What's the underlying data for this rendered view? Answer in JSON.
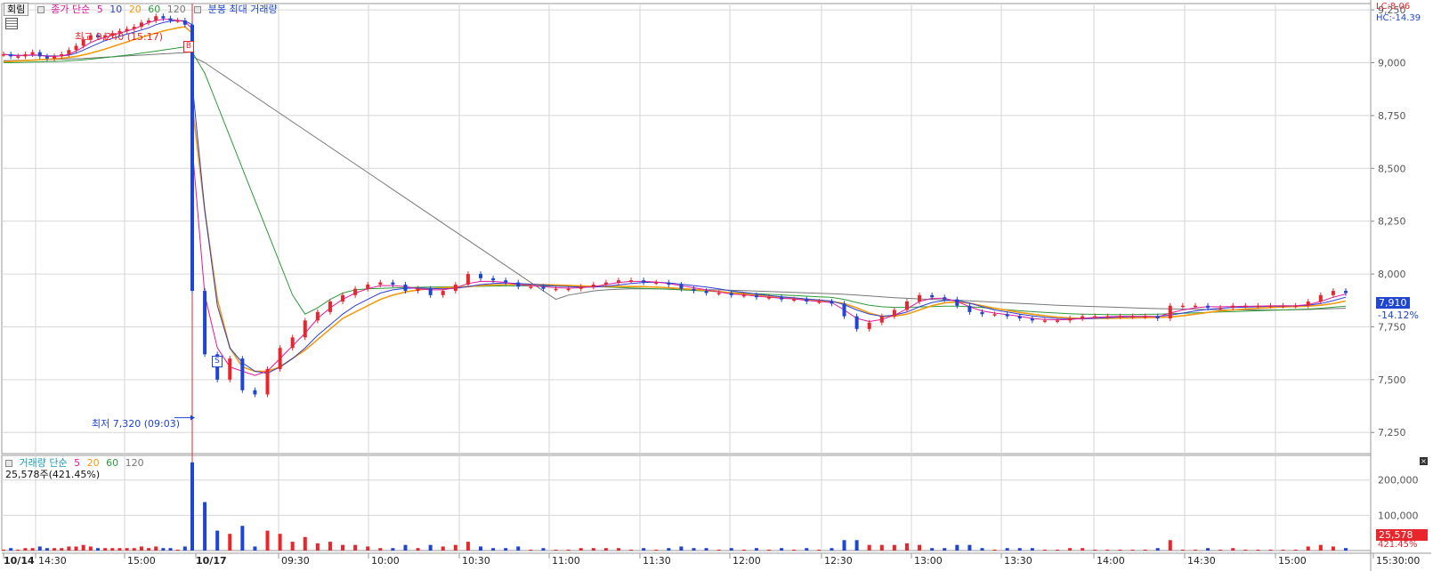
{
  "toolbar": {
    "mode_button": "회림",
    "price_legend": {
      "prefix": "종가 단순",
      "ma": [
        "5",
        "10",
        "20",
        "60",
        "120"
      ],
      "extra": "분봉 최대 거래량"
    },
    "volume_legend": {
      "prefix": "거래량 단순",
      "ma": [
        "5",
        "20",
        "60",
        "120"
      ],
      "current": "25,578주(421.45%)"
    }
  },
  "indicators": {
    "lc": "LC:8.06",
    "hc": "HC:-14.39"
  },
  "current_price": {
    "value": "7,910",
    "change": "-14.12%"
  },
  "current_volume": {
    "value": "25,578",
    "pct": "421.45%"
  },
  "annotations": {
    "high": "최고 9,240 (15:17)",
    "low": "최저 7,320 (09:03)",
    "buy_marker": "B",
    "sell_marker": "S"
  },
  "colors": {
    "up": "#e8262c",
    "down": "#1f45d1",
    "ma5": "#e0189c",
    "ma10": "#2e3fd7",
    "ma20": "#f29b0c",
    "ma60": "#2d9a3a",
    "ma120": "#777777",
    "grid": "#d6d6d6"
  },
  "chart_data": {
    "type": "line",
    "price_axis": {
      "ticks": [
        "9,250",
        "9,000",
        "8,750",
        "8,500",
        "8,250",
        "8,000",
        "7,750",
        "7,500",
        "7,250"
      ],
      "ylim": [
        7150,
        9280
      ]
    },
    "volume_axis": {
      "ticks": [
        "200,000",
        "100,000"
      ],
      "ylim": [
        0,
        270000
      ]
    },
    "x_ticks": [
      "10/14",
      "14:30",
      "15:00",
      "10/17",
      "09:30",
      "10:00",
      "10:30",
      "11:00",
      "11:30",
      "12:00",
      "12:30",
      "13:00",
      "13:30",
      "14:00",
      "14:30",
      "15:00",
      "15:30:00"
    ],
    "series": [
      {
        "name": "종가",
        "values": [
          9040,
          9030,
          9030,
          9040,
          9050,
          9030,
          9020,
          9030,
          9040,
          9060,
          9080,
          9110,
          9130,
          9120,
          9130,
          9140,
          9150,
          9160,
          9170,
          9190,
          9200,
          9220,
          9210,
          9200,
          9200,
          9180,
          9100,
          7920,
          7620,
          7500,
          7600,
          7450,
          7430,
          7550,
          7650,
          7700,
          7780,
          7820,
          7870,
          7900,
          7930,
          7950,
          7960,
          7950,
          7920,
          7930,
          7900,
          7920,
          7950,
          8000,
          7980,
          7970,
          7960,
          7940,
          7940,
          7930,
          7930,
          7930,
          7940,
          7950,
          7960,
          7970,
          7970,
          7960,
          7960,
          7950,
          7930,
          7920,
          7910,
          7910,
          7900,
          7900,
          7890,
          7890,
          7880,
          7880,
          7870,
          7870,
          7860,
          7800,
          7740,
          7770,
          7800,
          7830,
          7870,
          7900,
          7890,
          7880,
          7850,
          7820,
          7810,
          7810,
          7800,
          7790,
          7780,
          7780,
          7780,
          7790,
          7800,
          7800,
          7800,
          7800,
          7800,
          7800,
          7790,
          7850,
          7850,
          7850,
          7840,
          7840,
          7850,
          7850,
          7850,
          7850,
          7850,
          7850,
          7870,
          7900,
          7920,
          7910
        ]
      },
      {
        "name": "5",
        "values": [
          9040,
          9035,
          9033,
          9035,
          9038,
          9035,
          9030,
          9030,
          9032,
          9040,
          9055,
          9075,
          9095,
          9110,
          9120,
          9130,
          9140,
          9150,
          9160,
          9175,
          9190,
          9200,
          9205,
          9205,
          9200,
          9195,
          9160,
          8600,
          7900,
          7650,
          7560,
          7540,
          7520,
          7540,
          7600,
          7660,
          7720,
          7790,
          7840,
          7880,
          7910,
          7930,
          7945,
          7945,
          7940,
          7930,
          7925,
          7925,
          7935,
          7955,
          7965,
          7965,
          7960,
          7950,
          7945,
          7940,
          7935,
          7933,
          7935,
          7940,
          7950,
          7960,
          7965,
          7965,
          7962,
          7955,
          7945,
          7935,
          7925,
          7915,
          7905,
          7902,
          7895,
          7890,
          7885,
          7882,
          7875,
          7870,
          7865,
          7830,
          7790,
          7775,
          7785,
          7805,
          7835,
          7870,
          7885,
          7885,
          7870,
          7845,
          7825,
          7815,
          7808,
          7800,
          7790,
          7785,
          7783,
          7785,
          7790,
          7795,
          7798,
          7800,
          7800,
          7800,
          7797,
          7815,
          7830,
          7840,
          7845,
          7845,
          7846,
          7847,
          7848,
          7849,
          7850,
          7850,
          7855,
          7870,
          7890,
          7905
        ]
      },
      {
        "name": "10",
        "values": [
          9040,
          9037,
          9035,
          9035,
          9036,
          9035,
          9033,
          9032,
          9033,
          9036,
          9045,
          9060,
          9075,
          9090,
          9105,
          9115,
          9125,
          9135,
          9145,
          9155,
          9165,
          9180,
          9190,
          9197,
          9200,
          9198,
          9180,
          8900,
          8300,
          7850,
          7650,
          7580,
          7540,
          7530,
          7560,
          7600,
          7650,
          7710,
          7760,
          7810,
          7850,
          7880,
          7910,
          7925,
          7932,
          7934,
          7932,
          7930,
          7932,
          7940,
          7950,
          7955,
          7958,
          7955,
          7952,
          7948,
          7943,
          7940,
          7938,
          7938,
          7942,
          7948,
          7955,
          7960,
          7961,
          7958,
          7952,
          7945,
          7938,
          7930,
          7920,
          7913,
          7905,
          7898,
          7892,
          7887,
          7882,
          7877,
          7872,
          7855,
          7830,
          7810,
          7800,
          7805,
          7820,
          7845,
          7865,
          7875,
          7875,
          7862,
          7845,
          7830,
          7820,
          7810,
          7802,
          7795,
          7790,
          7788,
          7788,
          7790,
          7793,
          7796,
          7798,
          7799,
          7799,
          7805,
          7815,
          7825,
          7833,
          7838,
          7841,
          7843,
          7845,
          7847,
          7848,
          7849,
          7852,
          7860,
          7874,
          7890
        ]
      },
      {
        "name": "20",
        "values": [
          9005,
          9006,
          9008,
          9010,
          9012,
          9014,
          9016,
          9018,
          9021,
          9025,
          9030,
          9037,
          9045,
          9055,
          9065,
          9076,
          9087,
          9098,
          9110,
          9120,
          9130,
          9140,
          9150,
          9158,
          9165,
          9170,
          9140,
          8800,
          8300,
          7880,
          7650,
          7560,
          7540,
          7540,
          7560,
          7600,
          7640,
          7690,
          7740,
          7790,
          7820,
          7850,
          7880,
          7900,
          7915,
          7925,
          7930,
          7935,
          7937,
          7940,
          7945,
          7948,
          7950,
          7951,
          7951,
          7950,
          7948,
          7946,
          7944,
          7942,
          7941,
          7941,
          7941,
          7940,
          7938,
          7935,
          7931,
          7927,
          7922,
          7917,
          7911,
          7906,
          7900,
          7895,
          7890,
          7885,
          7880,
          7875,
          7870,
          7860,
          7840,
          7815,
          7800,
          7800,
          7810,
          7830,
          7850,
          7863,
          7868,
          7862,
          7850,
          7838,
          7828,
          7818,
          7810,
          7802,
          7796,
          7792,
          7790,
          7790,
          7790,
          7791,
          7792,
          7793,
          7794,
          7797,
          7802,
          7810,
          7818,
          7825,
          7830,
          7834,
          7838,
          7841,
          7844,
          7846,
          7848,
          7852,
          7860,
          7872
        ]
      },
      {
        "name": "60",
        "values": [
          9000,
          9000,
          9001,
          9002,
          9003,
          9004,
          9005,
          9006,
          9007,
          9009,
          9011,
          9014,
          9017,
          9020,
          9024,
          9028,
          9032,
          9036,
          9040,
          9045,
          9050,
          9055,
          9060,
          9065,
          9070,
          9075,
          9070,
          9050,
          8950,
          8800,
          8650,
          8500,
          8350,
          8200,
          8050,
          7900,
          7810,
          7840,
          7880,
          7910,
          7925,
          7930,
          7932,
          7934,
          7936,
          7937,
          7938,
          7939,
          7940,
          7941,
          7942,
          7943,
          7944,
          7944,
          7944,
          7944,
          7943,
          7942,
          7941,
          7940,
          7938,
          7936,
          7934,
          7932,
          7930,
          7928,
          7925,
          7922,
          7919,
          7916,
          7913,
          7910,
          7907,
          7904,
          7901,
          7898,
          7895,
          7892,
          7889,
          7880,
          7865,
          7852,
          7845,
          7842,
          7842,
          7844,
          7846,
          7848,
          7848,
          7845,
          7841,
          7836,
          7831,
          7826,
          7822,
          7818,
          7815,
          7812,
          7810,
          7809,
          7808,
          7808,
          7808,
          7809,
          7810,
          7812,
          7814,
          7816,
          7818,
          7820,
          7822,
          7824,
          7826,
          7828,
          7830,
          7832,
          7834,
          7838,
          7843,
          7848
        ]
      },
      {
        "name": "120",
        "values": [
          9010,
          9010,
          9011,
          9012,
          9013,
          9014,
          9015,
          9016,
          9017,
          9018,
          9019,
          9020,
          9022,
          9024,
          9026,
          9028,
          9030,
          9032,
          9034,
          9036,
          9038,
          9040,
          9042,
          9044,
          9046,
          9048,
          9050,
          9030,
          9000,
          8960,
          8920,
          8880,
          8840,
          8800,
          8760,
          8720,
          8680,
          8640,
          8600,
          8560,
          8520,
          8480,
          8440,
          8400,
          8360,
          8320,
          8280,
          8240,
          8200,
          8160,
          8120,
          8080,
          8040,
          8000,
          7960,
          7920,
          7880,
          7900,
          7910,
          7920,
          7925,
          7928,
          7930,
          7930,
          7930,
          7929,
          7928,
          7927,
          7926,
          7925,
          7923,
          7921,
          7919,
          7917,
          7915,
          7913,
          7911,
          7909,
          7907,
          7904,
          7900,
          7896,
          7892,
          7888,
          7885,
          7882,
          7880,
          7878,
          7876,
          7873,
          7870,
          7867,
          7864,
          7861,
          7858,
          7855,
          7852,
          7850,
          7848,
          7846,
          7844,
          7842,
          7840,
          7838,
          7836,
          7835,
          7834,
          7833,
          7832,
          7831,
          7830,
          7830,
          7830,
          7830,
          7830,
          7831,
          7832,
          7834,
          7836,
          7838
        ]
      }
    ]
  }
}
